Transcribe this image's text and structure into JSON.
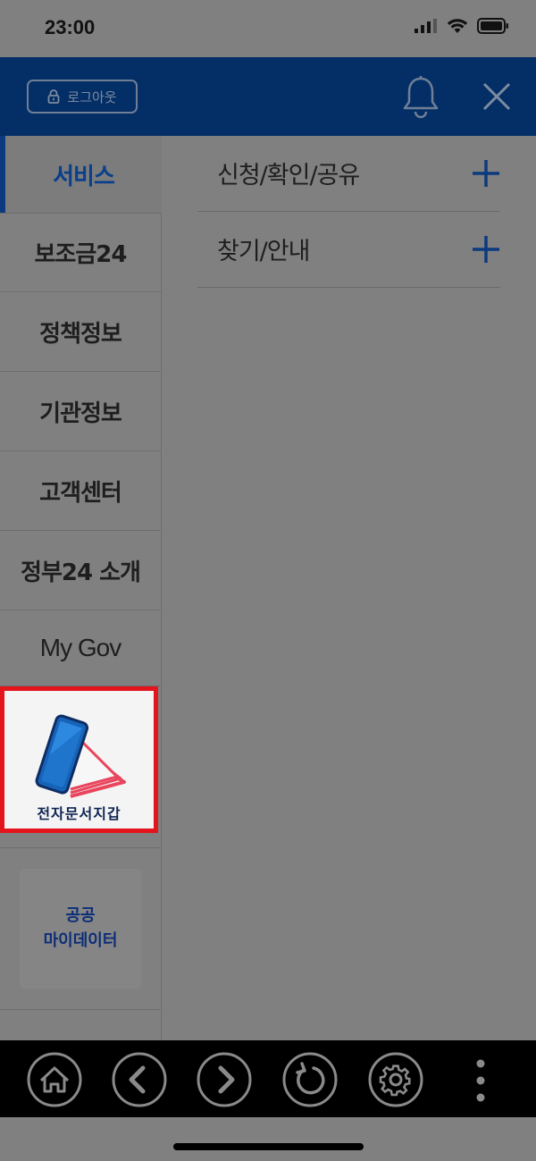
{
  "status_bar": {
    "time": "23:00"
  },
  "header": {
    "logout_label": "로그아웃"
  },
  "sidebar": {
    "items": [
      {
        "label": "서비스"
      },
      {
        "label": "보조금24"
      },
      {
        "label": "정책정보"
      },
      {
        "label": "기관정보"
      },
      {
        "label": "고객센터"
      },
      {
        "label": "정부24 소개"
      },
      {
        "label": "My Gov"
      }
    ],
    "wallet_label": "전자문서지갑",
    "public_mydata": {
      "line1": "공공",
      "line2": "마이데이터"
    }
  },
  "content": {
    "rows": [
      {
        "label": "신청/확인/공유"
      },
      {
        "label": "찾기/안내"
      }
    ]
  },
  "colors": {
    "header_bg": "#032e66",
    "accent": "#0b3a7e",
    "highlight_border": "#e4141c",
    "overlay": "#808080"
  },
  "icons": [
    "lock-icon",
    "bell-icon",
    "close-icon",
    "plus-icon",
    "home-icon",
    "back-icon",
    "forward-icon",
    "refresh-icon",
    "settings-icon",
    "more-icon"
  ]
}
